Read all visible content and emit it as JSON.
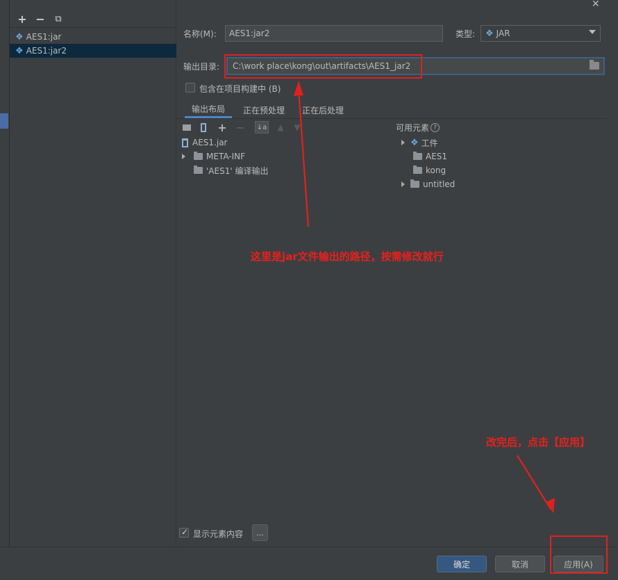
{
  "window": {
    "close_glyph": "✕"
  },
  "left_toolbar": {
    "add": "+",
    "remove": "−",
    "copy": "⧉"
  },
  "artifacts": [
    {
      "label": "AES1:jar",
      "selected": false
    },
    {
      "label": "AES1:jar2",
      "selected": true
    }
  ],
  "form": {
    "name_label": "名称(M):",
    "name_value": "AES1:jar2",
    "type_label": "类型:",
    "type_value": "JAR",
    "output_label": "输出目录:",
    "output_value": "C:\\work place\\kong\\out\\artifacts\\AES1_jar2",
    "include_label": "包含在项目构建中 (B)",
    "include_checked": false
  },
  "tabs": [
    {
      "label": "输出布局",
      "active": true
    },
    {
      "label": "正在预处理",
      "active": false
    },
    {
      "label": "正在后处理",
      "active": false
    }
  ],
  "layout_tree": {
    "root": "AES1.jar",
    "children": [
      "META-INF",
      "'AES1' 编译输出"
    ]
  },
  "available": {
    "header": "可用元素",
    "help": "?",
    "items": [
      "工件",
      "AES1",
      "kong",
      "untitled"
    ]
  },
  "bottom": {
    "show_content_label": "显示元素内容",
    "show_content_checked": true,
    "ellipsis": "...",
    "ok": "确定",
    "cancel": "取消",
    "apply": "应用(A)"
  },
  "annotations": {
    "path_note": "这里是jar文件输出的路径，按需修改就行",
    "apply_note": "改完后，点击【应用】",
    "color": "#e8201d"
  }
}
